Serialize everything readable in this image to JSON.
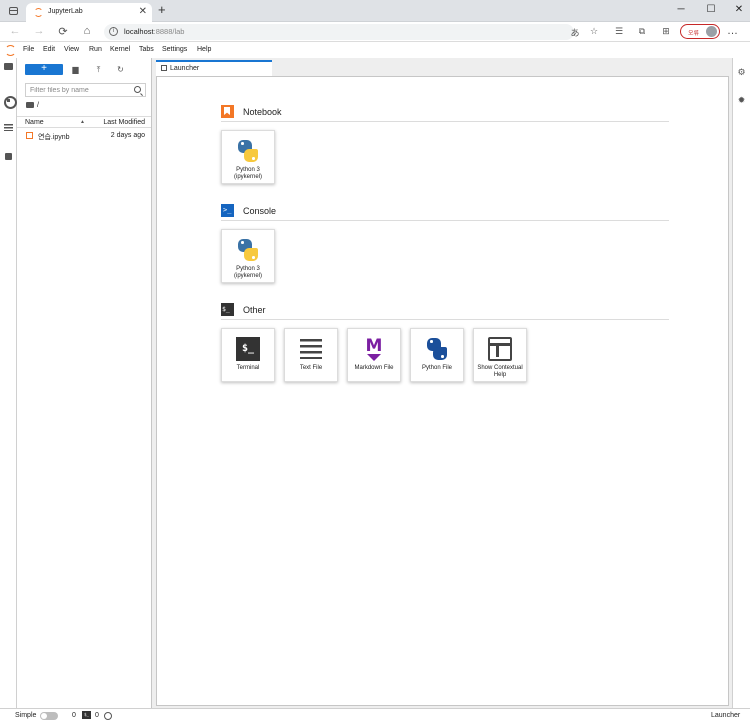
{
  "browser": {
    "tab_title": "JupyterLab",
    "url_host": "localhost",
    "url_path": ":8888/lab",
    "profile_label": "오류",
    "new_tab": "+",
    "close_tab": "✕",
    "minimize": "─",
    "maximize": "☐",
    "close_window": "✕",
    "back": "←",
    "forward": "→",
    "refresh": "⟳",
    "home": "⌂",
    "more": "…"
  },
  "menubar": {
    "items": [
      "File",
      "Edit",
      "View",
      "Run",
      "Kernel",
      "Tabs",
      "Settings",
      "Help"
    ]
  },
  "filebrowser": {
    "new_label": "+",
    "filter_placeholder": "Filter files by name",
    "breadcrumb": "/",
    "columns": {
      "name": "Name",
      "sort_indicator": "▲",
      "modified": "Last Modified"
    },
    "files": [
      {
        "name": "연습.ipynb",
        "modified": "2 days ago",
        "icon": "notebook-icon"
      }
    ]
  },
  "main": {
    "tab_label": "Launcher",
    "sections": [
      {
        "title": "Notebook",
        "icon": "notebook-section-icon",
        "cards": [
          {
            "label": "Python 3 (ipykernel)",
            "icon": "python-icon"
          }
        ]
      },
      {
        "title": "Console",
        "icon": "console-section-icon",
        "icon_text": ">_",
        "cards": [
          {
            "label": "Python 3 (ipykernel)",
            "icon": "python-icon"
          }
        ]
      },
      {
        "title": "Other",
        "icon": "other-section-icon",
        "icon_text": "$_",
        "cards": [
          {
            "label": "Terminal",
            "icon": "terminal-icon",
            "icon_text": "$_"
          },
          {
            "label": "Text File",
            "icon": "text-file-icon"
          },
          {
            "label": "Markdown File",
            "icon": "markdown-icon",
            "icon_text": "M"
          },
          {
            "label": "Python File",
            "icon": "python-file-icon"
          },
          {
            "label": "Show Contextual Help",
            "icon": "contextual-help-icon"
          }
        ]
      }
    ]
  },
  "statusbar": {
    "mode_label": "Simple",
    "terminals_count": "0",
    "terminal_icon_text": "$_",
    "kernels_count": "0",
    "right_label": "Launcher"
  },
  "colors": {
    "accent": "#1976d2",
    "jupyter_orange": "#f37726",
    "markdown_purple": "#7b1fa2",
    "profile_red": "#c62828"
  }
}
